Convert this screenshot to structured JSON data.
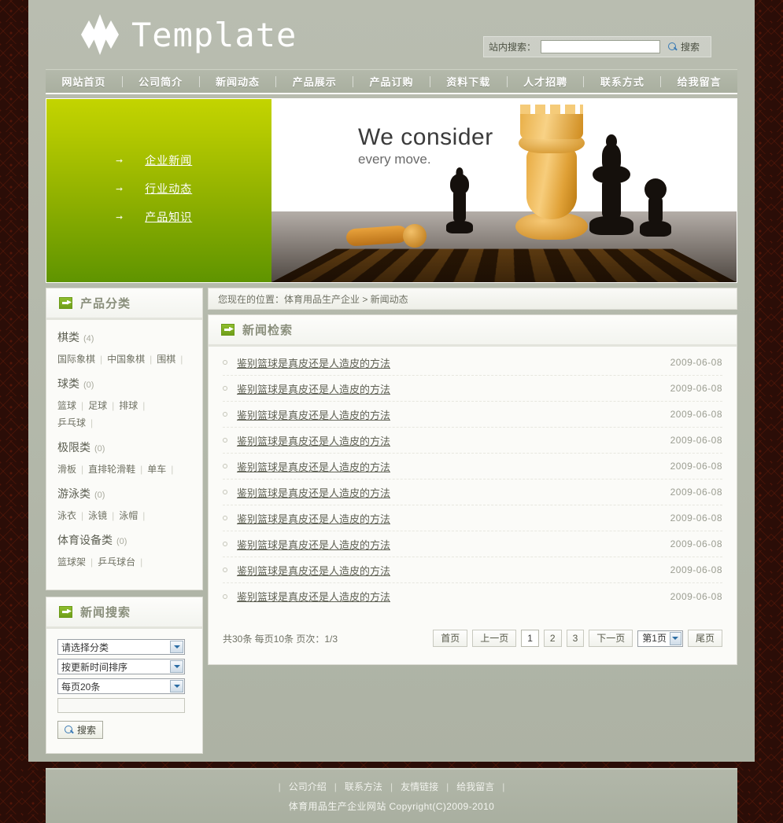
{
  "site": {
    "logo_text": "Template",
    "logo_icon": "diamond-cluster-icon"
  },
  "search": {
    "label": "站内搜索：",
    "value": "",
    "placeholder": "",
    "button": "搜索",
    "icon": "magnifier-icon"
  },
  "nav": {
    "items": [
      {
        "label": "网站首页"
      },
      {
        "label": "公司简介"
      },
      {
        "label": "新闻动态"
      },
      {
        "label": "产品展示"
      },
      {
        "label": "产品订购"
      },
      {
        "label": "资料下载"
      },
      {
        "label": "人才招聘"
      },
      {
        "label": "联系方式"
      },
      {
        "label": "给我留言"
      }
    ]
  },
  "banner": {
    "links": [
      {
        "label": "企业新闻",
        "arrow": "arrow-right-icon"
      },
      {
        "label": "行业动态",
        "arrow": "arrow-right-icon"
      },
      {
        "label": "产品知识",
        "arrow": "arrow-right-icon"
      }
    ],
    "headline": "We consider",
    "subline": "every move.",
    "image_alt": "chess-pieces-photo"
  },
  "breadcrumb": {
    "text": "您现在的位置：体育用品生产企业  >  新闻动态"
  },
  "categories_panel": {
    "title": "产品分类",
    "icon": "arrow-square-icon",
    "groups": [
      {
        "name": "棋类",
        "count": "(4)",
        "subs": [
          "国际象棋",
          "中国象棋",
          "围棋"
        ]
      },
      {
        "name": "球类",
        "count": "(0)",
        "subs": [
          "篮球",
          "足球",
          "排球",
          "乒乓球"
        ]
      },
      {
        "name": "极限类",
        "count": "(0)",
        "subs": [
          "滑板",
          "直排轮滑鞋",
          "单车"
        ]
      },
      {
        "name": "游泳类",
        "count": "(0)",
        "subs": [
          "泳衣",
          "泳镜",
          "泳帽"
        ]
      },
      {
        "name": "体育设备类",
        "count": "(0)",
        "subs": [
          "篮球架",
          "乒乓球台"
        ]
      }
    ]
  },
  "news_search_panel": {
    "title": "新闻搜索",
    "icon": "arrow-square-icon",
    "category_select": "请选择分类",
    "sort_select": "按更新时间排序",
    "pagesize_select": "每页20条",
    "keyword_value": "",
    "keyword_placeholder": "",
    "button": "搜索",
    "button_icon": "magnifier-icon"
  },
  "news_panel": {
    "title": "新闻检索",
    "icon": "arrow-square-icon",
    "rows": [
      {
        "title": "鉴别篮球是真皮还是人造皮的方法",
        "date": "2009-06-08"
      },
      {
        "title": "鉴别篮球是真皮还是人造皮的方法",
        "date": "2009-06-08"
      },
      {
        "title": "鉴别篮球是真皮还是人造皮的方法",
        "date": "2009-06-08"
      },
      {
        "title": "鉴别篮球是真皮还是人造皮的方法",
        "date": "2009-06-08"
      },
      {
        "title": "鉴别篮球是真皮还是人造皮的方法",
        "date": "2009-06-08"
      },
      {
        "title": "鉴别篮球是真皮还是人造皮的方法",
        "date": "2009-06-08"
      },
      {
        "title": "鉴别篮球是真皮还是人造皮的方法",
        "date": "2009-06-08"
      },
      {
        "title": "鉴别篮球是真皮还是人造皮的方法",
        "date": "2009-06-08"
      },
      {
        "title": "鉴别篮球是真皮还是人造皮的方法",
        "date": "2009-06-08"
      },
      {
        "title": "鉴别篮球是真皮还是人造皮的方法",
        "date": "2009-06-08"
      }
    ]
  },
  "pagination": {
    "info": "共30条 每页10条 页次：1/3",
    "first": "首页",
    "prev": "上一页",
    "pages": [
      "1",
      "2",
      "3"
    ],
    "current_page": "1",
    "next": "下一页",
    "jump_select": "第1页",
    "last": "尾页"
  },
  "footer": {
    "links": [
      "公司介绍",
      "联系方法",
      "友情链接",
      "给我留言"
    ],
    "copyright": "体育用品生产企业网站  Copyright(C)2009-2010"
  },
  "colors": {
    "page_bg": "#2b0d07",
    "shell_bg": "#b3b8aa",
    "accent_green": "#8fbe2e",
    "banner_green_top": "#c3d400",
    "banner_green_bottom": "#5f9400",
    "panel_bg": "#fbfbf8",
    "link_text": "#5e6053"
  }
}
